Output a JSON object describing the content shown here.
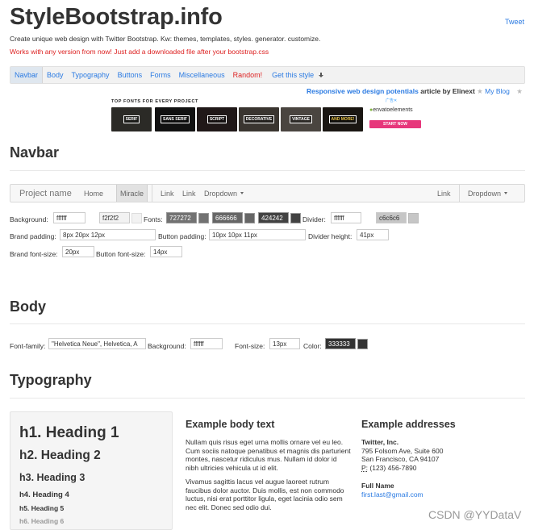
{
  "header": {
    "title": "StyleBootstrap.info",
    "tweet": "Tweet",
    "tagline": "Create unique web design with Twitter Bootstrap. Kw: themes, templates, styles. generator. customize.",
    "notice": "Works with any version from now! Just add a downloaded file after your bootstrap.css"
  },
  "topnav": {
    "items": [
      "Navbar",
      "Body",
      "Typography",
      "Buttons",
      "Forms",
      "Miscellaneous",
      "Random!",
      "Get this style"
    ],
    "active_index": 0
  },
  "adline": {
    "link1": "Responsive web design potentials",
    "mid": " article by Elinext ",
    "star": "★",
    "blog": "My Blog",
    "star2": "★"
  },
  "ad": {
    "heading": "TOP FONTS FOR EVERY PROJECT",
    "tiles": [
      "SERIF",
      "SANS SERIF",
      "SCRIPT",
      "DECORATIVE",
      "VINTAGE",
      "AND MORE!"
    ],
    "adchoice": "广告✕",
    "brand": "envatoelements",
    "cta": "START NOW"
  },
  "navbar_section": {
    "title": "Navbar",
    "demo": {
      "brand": "Project name",
      "home": "Home",
      "active": "Miracle",
      "link1": "Link",
      "link2": "Link",
      "dropdown1": "Dropdown",
      "link3": "Link",
      "dropdown2": "Dropdown"
    },
    "controls": {
      "background_label": "Background:",
      "background_value": "ffffff",
      "bg2_value": "f2f2f2",
      "fonts_label": "Fonts:",
      "font1": "727272",
      "font2": "666666",
      "font3": "424242",
      "divider_label": "Divider:",
      "divider_value": "ffffff",
      "divider2_value": "c6c6c6",
      "brand_padding_label": "Brand padding:",
      "brand_padding_value": "8px 20px 12px",
      "button_padding_label": "Button padding:",
      "button_padding_value": "10px 10px 11px",
      "divider_height_label": "Divider height:",
      "divider_height_value": "41px",
      "brand_fontsize_label": "Brand font-size:",
      "brand_fontsize_value": "20px",
      "button_fontsize_label": "Button font-size:",
      "button_fontsize_value": "14px"
    },
    "colors": {
      "c1": "#f2f2f2",
      "c2": "#727272",
      "c3": "#666666",
      "c4": "#424242",
      "c5": "#c6c6c6"
    }
  },
  "body_section": {
    "title": "Body",
    "fontfamily_label": "Font-family:",
    "fontfamily_value": "\"Helvetica Neue\", Helvetica, A",
    "background_label": "Background:",
    "background_value": "ffffff",
    "fontsize_label": "Font-size:",
    "fontsize_value": "13px",
    "color_label": "Color:",
    "color_value": "333333"
  },
  "typography_section": {
    "title": "Typography",
    "headings": [
      "h1. Heading 1",
      "h2. Heading 2",
      "h3. Heading 3",
      "h4. Heading 4",
      "h5. Heading 5",
      "h6. Heading 6"
    ],
    "body_title": "Example body text",
    "para1": "Nullam quis risus eget urna mollis ornare vel eu leo. Cum sociis natoque penatibus et magnis dis parturient montes, nascetur ridiculus mus. Nullam id dolor id nibh ultricies vehicula ut id elit.",
    "para2": "Vivamus sagittis lacus vel augue laoreet rutrum faucibus dolor auctor. Duis mollis, est non commodo luctus, nisi erat porttitor ligula, eget lacinia odio sem nec elit. Donec sed odio dui.",
    "addr_title": "Example addresses",
    "company": "Twitter, Inc.",
    "street": "795 Folsom Ave, Suite 600",
    "city": "San Francisco, CA 94107",
    "phone_prefix": "P:",
    "phone": " (123) 456-7890",
    "fullname": "Full Name",
    "email": "first.last@gmail.com"
  },
  "watermark": "CSDN @YYDataV"
}
